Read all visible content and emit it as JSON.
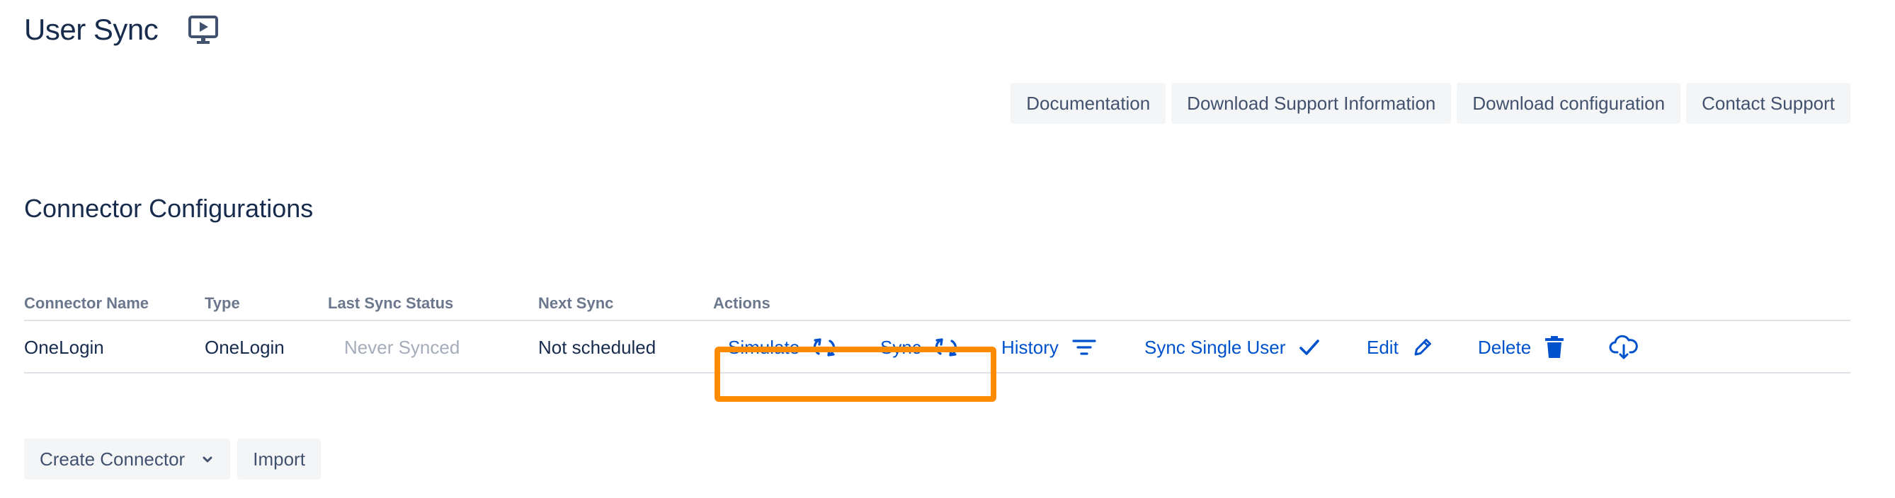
{
  "page": {
    "title": "User Sync",
    "title_icon": "presentation-play-icon"
  },
  "toolbar": {
    "buttons": [
      "Documentation",
      "Download Support Information",
      "Download configuration",
      "Contact Support"
    ]
  },
  "section": {
    "title": "Connector Configurations"
  },
  "table": {
    "headers": [
      "Connector Name",
      "Type",
      "Last Sync Status",
      "Next Sync",
      "Actions"
    ],
    "rows": [
      {
        "name": "OneLogin",
        "type": "OneLogin",
        "last_sync_status": "Never Synced",
        "next_sync": "Not scheduled",
        "actions": {
          "simulate": "Simulate",
          "sync": "Sync",
          "history": "History",
          "sync_single_user": "Sync Single User",
          "edit": "Edit",
          "delete": "Delete"
        }
      }
    ]
  },
  "bottom": {
    "create_connector": "Create Connector",
    "import": "Import"
  },
  "colors": {
    "link": "#0052cc",
    "highlight": "#ff8b00",
    "button_bg": "#f4f5f7",
    "text": "#172b4d",
    "muted": "#a5adba"
  }
}
